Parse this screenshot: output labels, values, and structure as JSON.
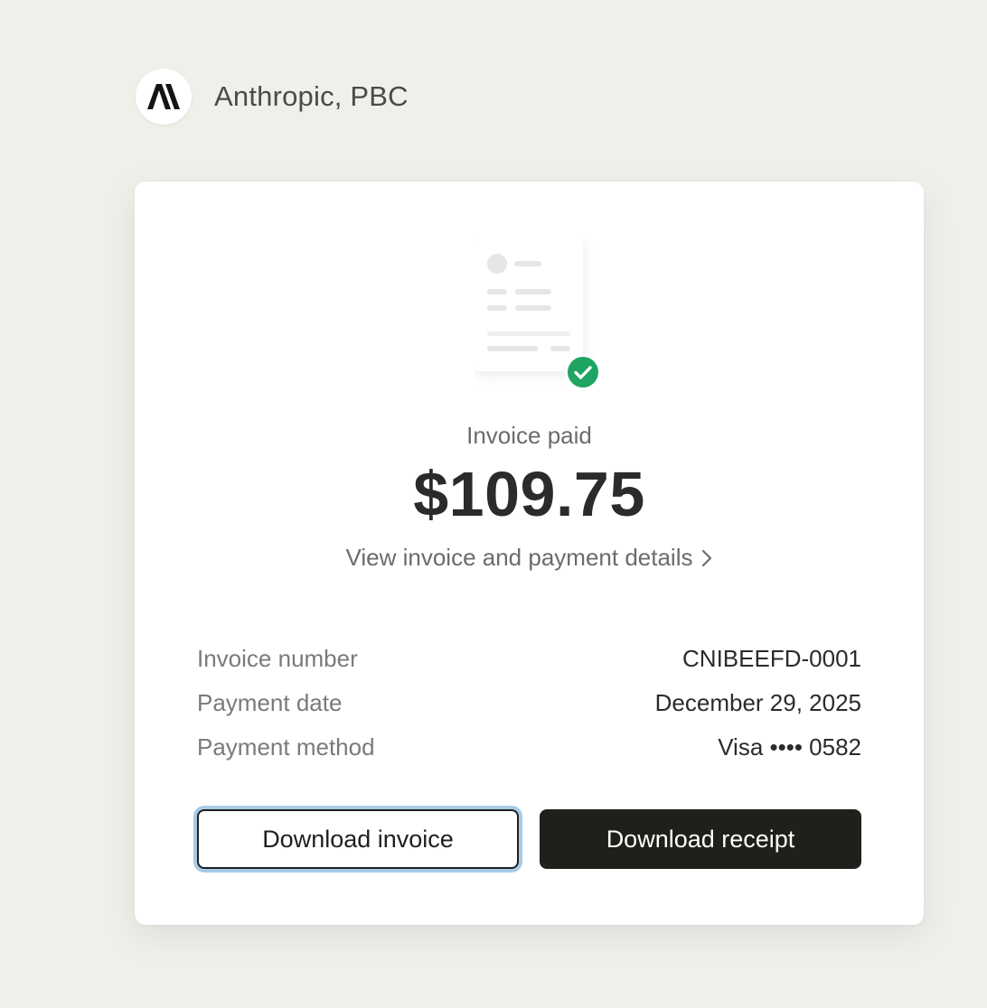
{
  "header": {
    "logo_text": "A\\",
    "company_name": "Anthropic, PBC"
  },
  "invoice": {
    "status": "Invoice paid",
    "amount": "$109.75",
    "details_link": "View invoice and payment details"
  },
  "details": [
    {
      "label": "Invoice number",
      "value": "CNIBEEFD-0001"
    },
    {
      "label": "Payment date",
      "value": "December 29, 2025"
    },
    {
      "label": "Payment method",
      "value": "Visa •••• 0582"
    }
  ],
  "buttons": {
    "download_invoice": "Download invoice",
    "download_receipt": "Download receipt"
  },
  "colors": {
    "background": "#f0f0eb",
    "card": "#ffffff",
    "success": "#1fa463",
    "primary_button": "#1f1f1c",
    "focus_ring": "#a7cbe6"
  },
  "icons": {
    "logo": "anthropic-logo",
    "illustration": "invoice-document-illustration",
    "paid_check": "check-circle-icon",
    "link_chevron": "chevron-right-icon"
  }
}
